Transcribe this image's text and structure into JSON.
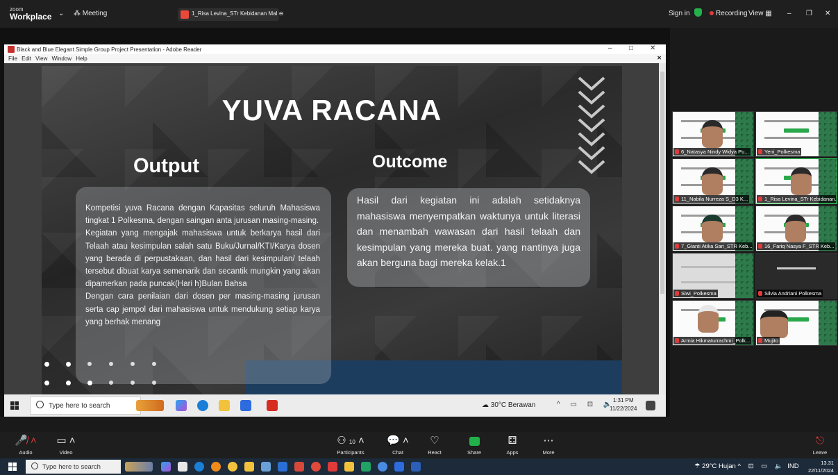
{
  "zoom": {
    "app_small": "zoom",
    "app_name": "Workplace",
    "meeting_label": "Meeting",
    "share_chip": "1_Risa Levina_STr Kebidanan Mal",
    "sign_in": "Sign in",
    "recording": "Recording",
    "view": "View"
  },
  "adobe": {
    "title": "Black and Blue Elegant Simple Group Project Presentation - Adobe Reader",
    "menu": [
      "File",
      "Edit",
      "View",
      "Window",
      "Help"
    ]
  },
  "slide": {
    "title": "YUVA RACANA",
    "output_heading": "Output",
    "outcome_heading": "Outcome",
    "output_paragraphs": [
      "Kompetisi yuva Racana dengan Kapasitas seluruh Mahasiswa tingkat 1 Polkesma, dengan saingan anta jurusan masing-masing.",
      "Kegiatan yang mengajak mahasiswa untuk berkarya hasil dari Telaah atau kesimpulan salah satu Buku/Jurnal/KTI/Karya dosen yang berada di perpustakaan, dan hasil dari kesimpulan/ telaah tersebut dibuat karya semenarik dan secantik mungkin yang akan dipamerkan pada puncak(Hari h)Bulan Bahsa",
      "Dengan cara penilaian dari dosen per masing-masing jurusan serta cap jempol dari mahasiswa untuk mendukung setiap karya yang berhak menang"
    ],
    "outcome_text": "Hasil dari kegiatan ini adalah setidaknya mahasiswa menyempatkan waktunya untuk literasi dan menambah wawasan dari hasil telaah dan kesimpulan yang mereka buat. yang nantinya juga akan berguna bagi mereka kelak.1"
  },
  "inner_taskbar": {
    "search_placeholder": "Type here to search",
    "weather": "30°C  Berawan",
    "time": "1:31 PM",
    "date": "11/22/2024"
  },
  "participants": [
    {
      "name": "6_Natasya Nindy Widya Pu..."
    },
    {
      "name": "Yeni_Polkesma"
    },
    {
      "name": "11_Nabila Nurreza S_D3 K..."
    },
    {
      "name": "1_Risa Levina_STr Kebidanan..."
    },
    {
      "name": "7_Gianti Atika Sari_STR Keb..."
    },
    {
      "name": "16_Fariq Nasya F_STR Keb..."
    },
    {
      "name": "Siwi_Polkesma"
    },
    {
      "name": "Silvia Andriani Polkesma"
    },
    {
      "name": "Armia Hikmaturrachmi_Polk..."
    },
    {
      "name": "Mujito"
    }
  ],
  "toolbar": {
    "audio": "Audio",
    "video": "Video",
    "participants": "Participants",
    "participants_count": "10",
    "chat": "Chat",
    "react": "React",
    "share": "Share",
    "apps": "Apps",
    "more": "More",
    "leave": "Leave"
  },
  "outer_taskbar": {
    "search_placeholder": "Type here to search",
    "weather": "29°C  Hujan",
    "lang": "IND",
    "time": "13.31",
    "date": "22/11/2024"
  },
  "colors": {
    "zoom_dark": "#1f1f1f",
    "share_green": "#21b14a",
    "record_red": "#e03b3b",
    "slide_blue": "#1d3d5e"
  }
}
